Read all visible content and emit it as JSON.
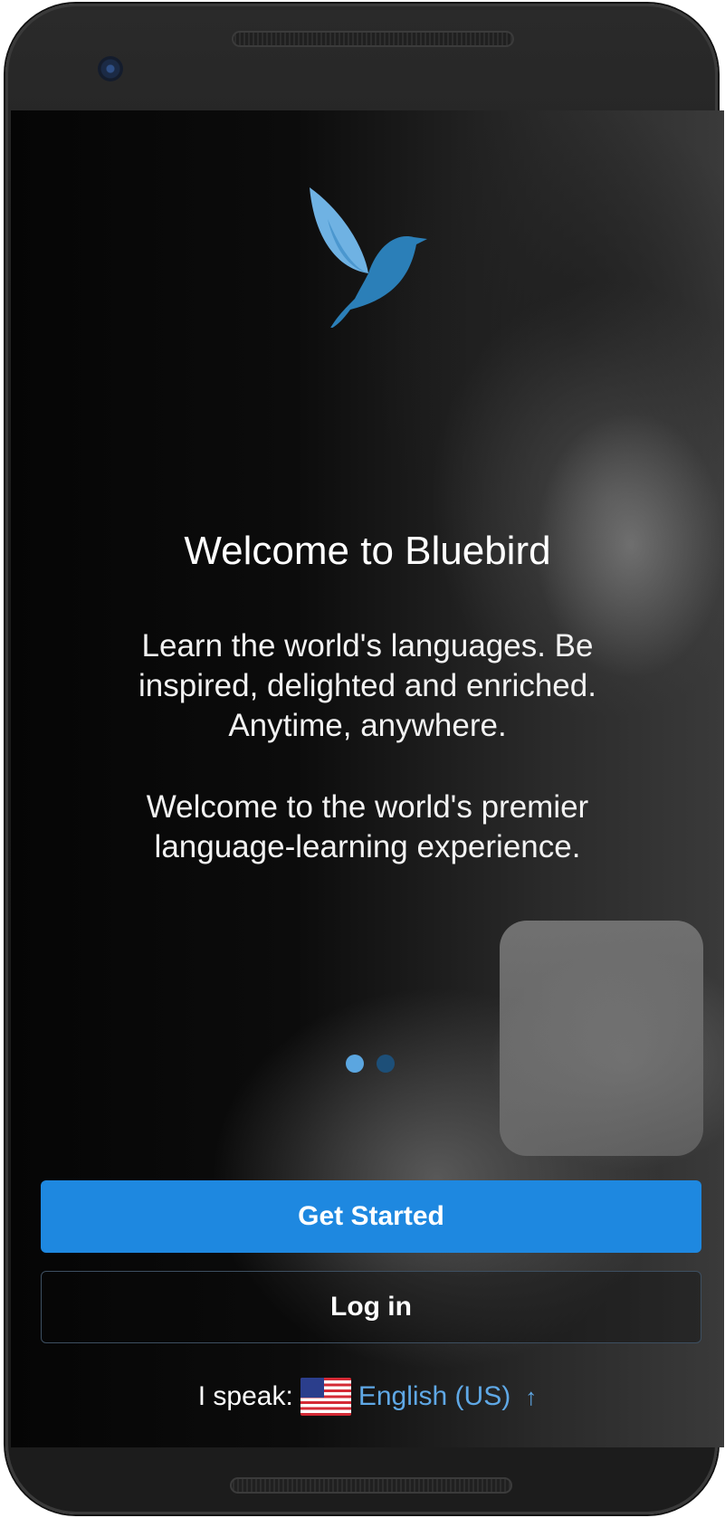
{
  "welcome": {
    "title": "Welcome to Bluebird",
    "paragraph1": "Learn the world's languages. Be inspired, delighted and enriched. Anytime, anywhere.",
    "paragraph2": "Welcome to the world's premier language-learning experience."
  },
  "pager": {
    "total": 2,
    "active_index": 0
  },
  "buttons": {
    "get_started": "Get Started",
    "log_in": "Log in"
  },
  "language": {
    "label": "I speak:",
    "flag_icon": "us-flag-icon",
    "selected": "English (US)",
    "expand_icon": "arrow-up-icon",
    "expand_glyph": "↑"
  },
  "colors": {
    "accent": "#1e88e0",
    "link": "#5fa8e6",
    "logo_light": "#6fb2e3",
    "logo_dark": "#2b7fb8"
  }
}
